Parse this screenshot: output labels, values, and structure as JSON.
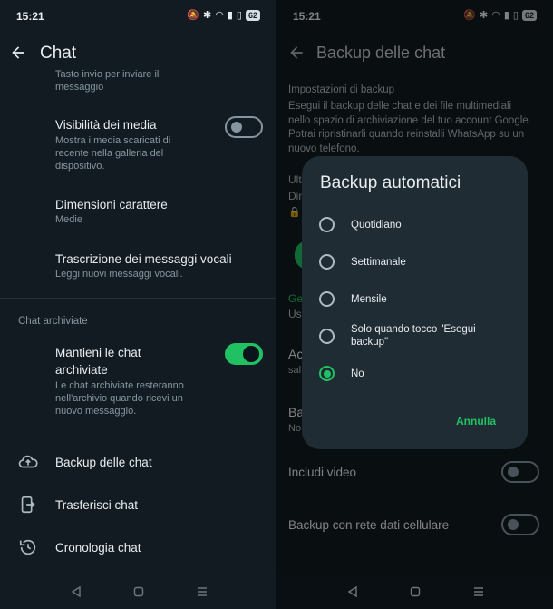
{
  "left": {
    "status_time": "15:21",
    "battery": "62",
    "title": "Chat",
    "items": {
      "prev_sub": "Tasto invio per inviare il messaggio",
      "media_title": "Visibilità dei media",
      "media_sub": "Mostra i media scaricati di recente nella galleria del dispositivo.",
      "font_title": "Dimensioni carattere",
      "font_sub": "Medie",
      "voice_title": "Trascrizione dei messaggi vocali",
      "voice_sub": "Leggi nuovi messaggi vocali."
    },
    "section_archived": "Chat archiviate",
    "archived": {
      "title": "Mantieni le chat archiviate",
      "sub": "Le chat archiviate resteranno nell'archivio quando ricevi un nuovo messaggio."
    },
    "links": {
      "backup": "Backup delle chat",
      "transfer": "Trasferisci chat",
      "history": "Cronologia chat"
    }
  },
  "right": {
    "status_time": "15:21",
    "battery": "62",
    "title": "Backup delle chat",
    "settings_label": "Impostazioni di backup",
    "settings_desc": "Esegui il backup delle chat e dei file multimediali nello spazio di archiviazione del tuo account Google. Potrai ripristinarli quando reinstalli WhatsApp su un nuovo telefono.",
    "partial": {
      "ult": "Ult",
      "dim": "Dim",
      "ge": "Ge",
      "us": "Us",
      "ac": "Ac",
      "sal": "sal",
      "ba": "Ba",
      "no": "No"
    },
    "include_video": "Includi video",
    "cellular_backup": "Backup con rete dati cellulare",
    "dialog": {
      "title": "Backup automatici",
      "options": [
        "Quotidiano",
        "Settimanale",
        "Mensile",
        "Solo quando tocco \"Esegui backup\"",
        "No"
      ],
      "selected": "No",
      "cancel": "Annulla"
    }
  },
  "colors": {
    "accent": "#21c063",
    "background": "#121b22",
    "dialog": "#202c33"
  }
}
